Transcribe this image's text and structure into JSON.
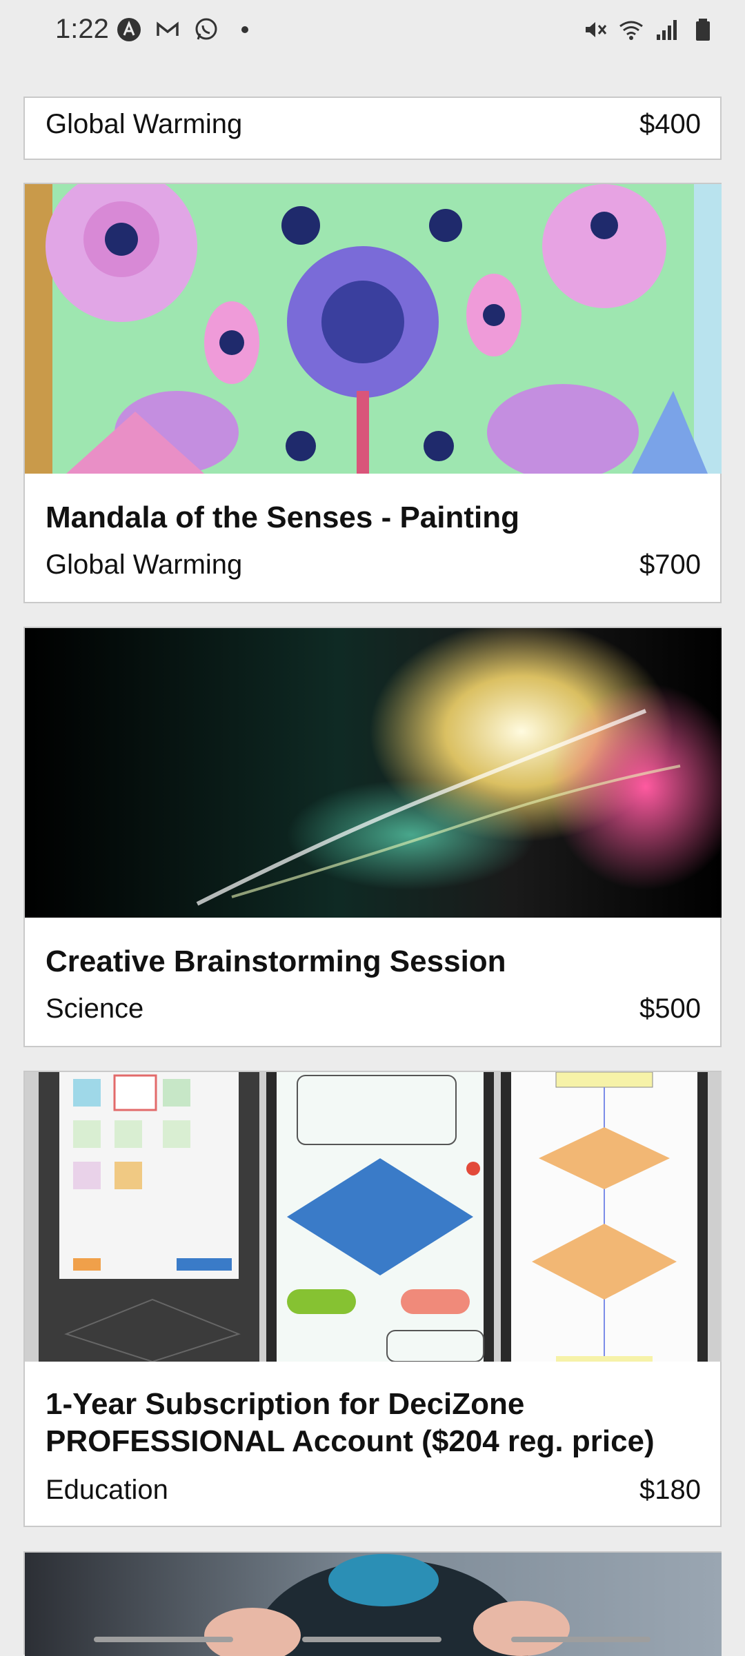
{
  "status_bar": {
    "time": "1:22",
    "left_icons": [
      "a-letter-icon",
      "mail-icon",
      "whatsapp-icon",
      "dot-icon"
    ],
    "right_icons": [
      "mute-icon",
      "wifi-icon",
      "signal-icon",
      "battery-icon"
    ]
  },
  "cards": [
    {
      "title": "",
      "category": "Global Warming",
      "price": "$400"
    },
    {
      "title": "Mandala of the Senses - Painting",
      "category": "Global Warming",
      "price": "$700",
      "image": "mandala-painting"
    },
    {
      "title": "Creative Brainstorming Session",
      "category": "Science",
      "price": "$500",
      "image": "colorful-smoke"
    },
    {
      "title_line1": "1-Year Subscription for DeciZone",
      "title_line2": "PROFESSIONAL Account ($204 reg. price)",
      "category": "Education",
      "price": "$180",
      "image": "app-flowchart-screens"
    },
    {
      "image": "person-hands-on-head"
    }
  ],
  "colors": {
    "background": "#ececec",
    "card": "#ffffff",
    "card_border": "#c9c9c9",
    "text": "#111111"
  }
}
